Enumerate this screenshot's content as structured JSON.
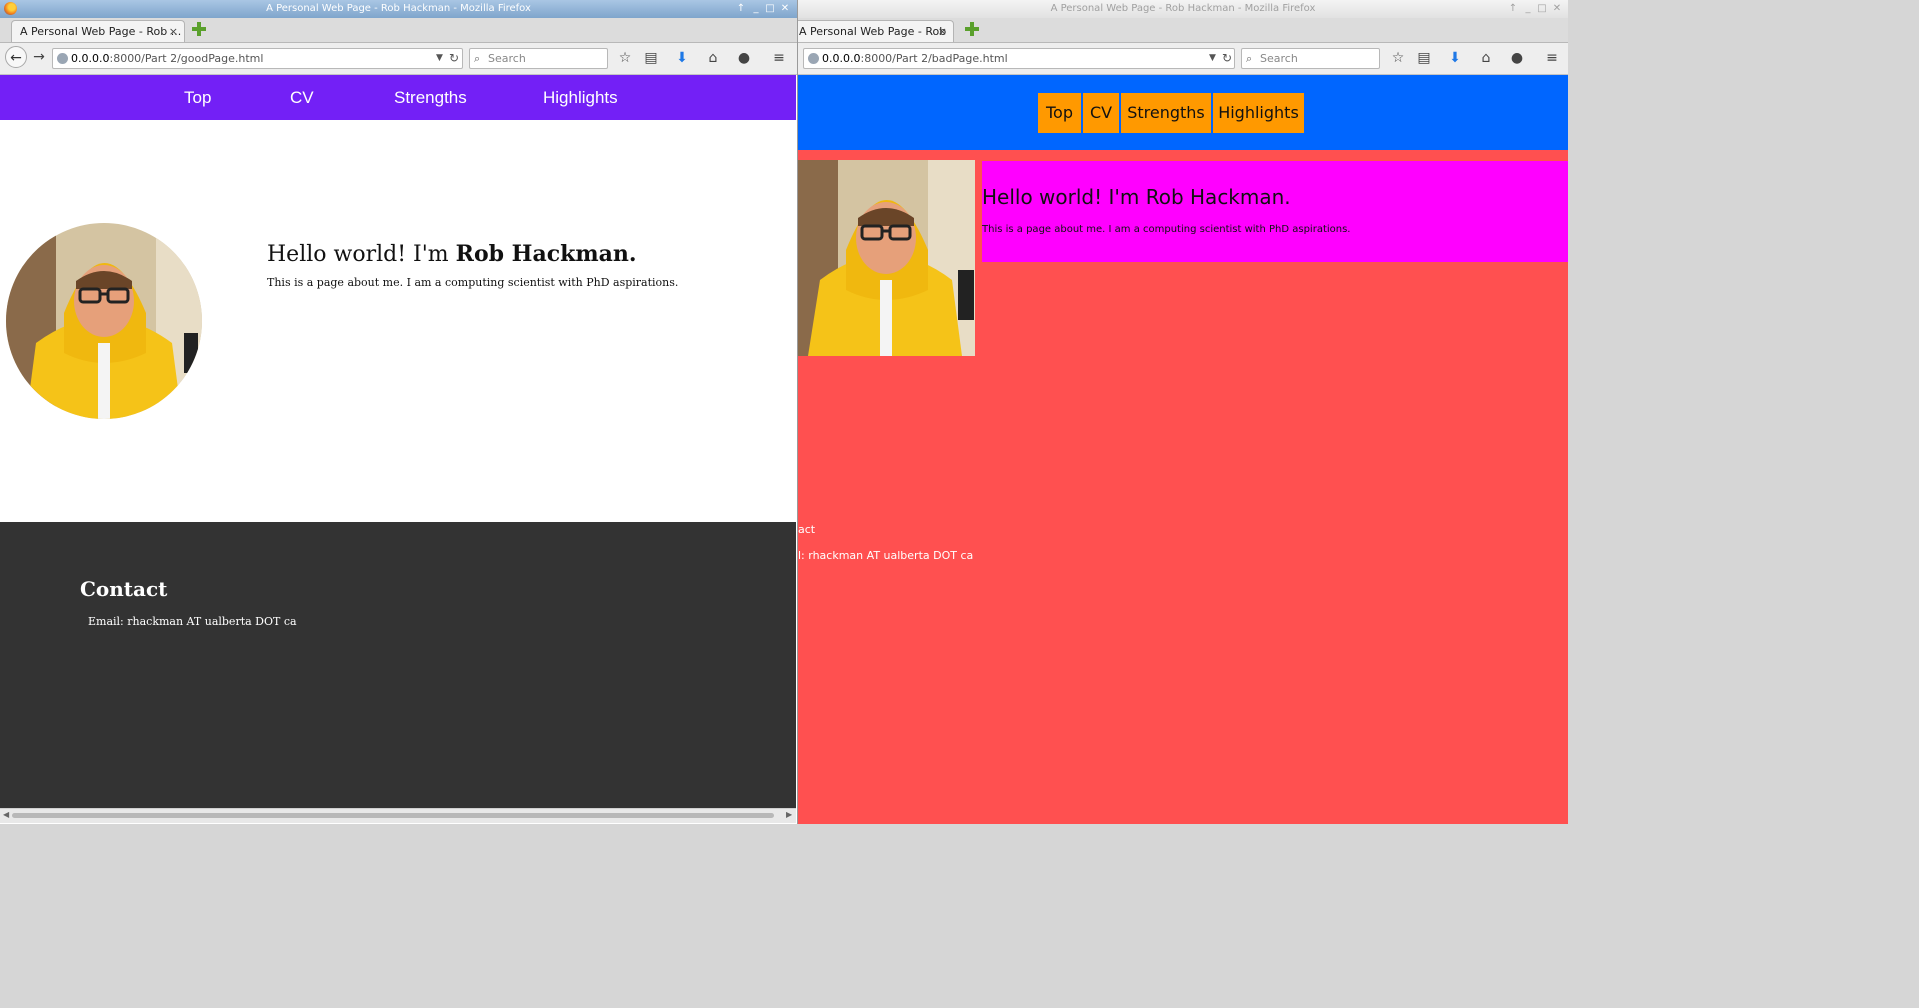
{
  "left_window": {
    "window_title": "A Personal Web Page - Rob Hackman - Mozilla Firefox",
    "tab_title": "A Personal Web Page - Rob ...",
    "tab_close": "×",
    "url_host": "0.0.0.0",
    "url_rest": ":8000/Part 2/goodPage.html",
    "search_placeholder": "Search",
    "page": {
      "nav": [
        "Top",
        "CV",
        "Strengths",
        "Highlights"
      ],
      "heading_prefix": "Hello world! I'm ",
      "heading_name": "Rob Hackman.",
      "description": "This is a page about me. I am a computing scientist with PhD aspirations.",
      "contact_heading": "Contact",
      "email": "Email: rhackman AT ualberta DOT ca"
    }
  },
  "right_window": {
    "window_title": "A Personal Web Page - Rob Hackman - Mozilla Firefox",
    "tab_title": "A Personal Web Page - Rob ...",
    "tab_close": "×",
    "url_host": "0.0.0.0",
    "url_rest": ":8000/Part 2/badPage.html",
    "search_placeholder": "Search",
    "page": {
      "nav": [
        "Top",
        "CV",
        "Strengths",
        "Highlights"
      ],
      "heading": "Hello world! I'm Rob Hackman.",
      "description": "This is a page about me. I am a computing scientist with PhD aspirations.",
      "contact_fragment": "act",
      "email_fragment": "l: rhackman AT ualberta DOT ca"
    }
  },
  "colors": {
    "good_nav": "#7320f6",
    "good_footer": "#333333",
    "bad_nav": "#0066ff",
    "bad_bg": "#ff5050",
    "bad_button": "#ff9900",
    "bad_box": "#ff00ff"
  },
  "icons": [
    "back-icon",
    "forward-icon",
    "globe-icon",
    "reload-icon",
    "bookmark-star-icon",
    "reading-list-icon",
    "downloads-icon",
    "home-icon",
    "chat-icon",
    "hamburger-menu-icon"
  ]
}
